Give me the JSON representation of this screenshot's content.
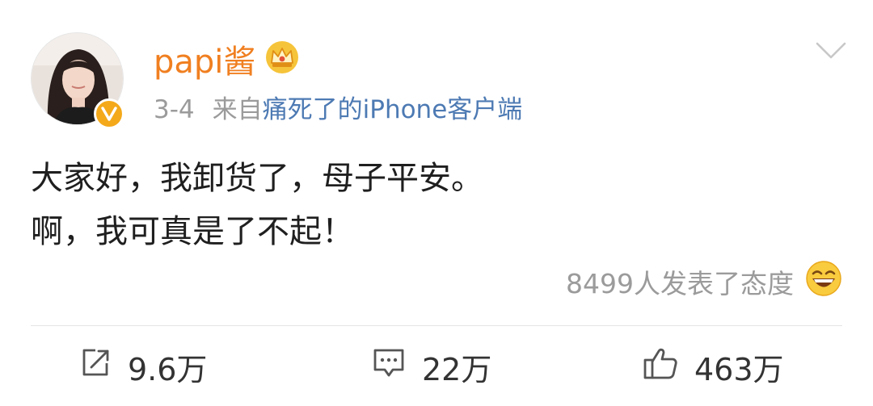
{
  "post": {
    "author": "papi酱",
    "time": "3-4",
    "source_prefix": "来自",
    "source_name": "痛死了的iPhone客户端",
    "text_line1": "大家好，我卸货了，母子平安。",
    "text_line2": "啊，我可真是了不起！",
    "reactions_text": "8499人发表了态度"
  },
  "actions": {
    "repost": "9.6万",
    "comment": "22万",
    "like": "463万"
  },
  "colors": {
    "username": "#f07f20",
    "source_link": "#4d7ab3",
    "verified_badge": "#f4a91b",
    "muted_text": "#9b9b9b"
  },
  "icons": {
    "badge": "verified-v-icon",
    "crown": "crown-icon",
    "menu": "chevron-down-icon",
    "reaction": "grin-emoji-icon",
    "repost": "repost-icon",
    "comment": "comment-icon",
    "like": "thumbs-up-icon"
  }
}
